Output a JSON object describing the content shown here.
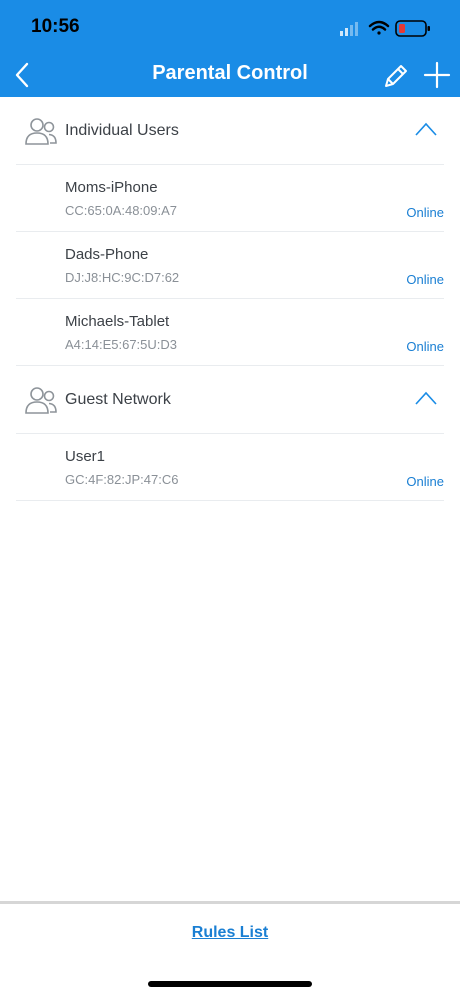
{
  "status_bar": {
    "time": "10:56"
  },
  "header": {
    "title": "Parental Control"
  },
  "groups": [
    {
      "title": "Individual Users",
      "items": [
        {
          "name": "Moms-iPhone",
          "mac": "CC:65:0A:48:09:A7",
          "status": "Online"
        },
        {
          "name": "Dads-Phone",
          "mac": "DJ:J8:HC:9C:D7:62",
          "status": "Online"
        },
        {
          "name": "Michaels-Tablet",
          "mac": "A4:14:E5:67:5U:D3",
          "status": "Online"
        }
      ]
    },
    {
      "title": "Guest Network",
      "items": [
        {
          "name": "User1",
          "mac": "GC:4F:82:JP:47:C6",
          "status": "Online"
        }
      ]
    }
  ],
  "footer": {
    "link_label": "Rules List"
  },
  "colors": {
    "primary": "#1a8ce6",
    "link": "#1a7fd3",
    "text": "#3c4147",
    "muted": "#8a9097"
  },
  "icons": [
    "back-icon",
    "edit-icon",
    "add-icon",
    "users-icon",
    "chevron-up-icon",
    "signal-icon",
    "wifi-icon",
    "battery-icon"
  ]
}
